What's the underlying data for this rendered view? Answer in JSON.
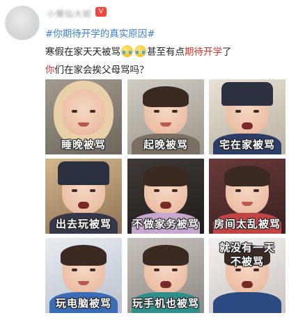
{
  "post": {
    "author": "小懒仙大妮",
    "vip_badge": "V",
    "hashtag": "#你期待开学的真实原因#",
    "line1_before": "寒假在家天天被骂",
    "line1_middle": "甚至有点",
    "line1_accent": "期待开学",
    "line1_after": "了",
    "line2_accent": "你",
    "line2_rest": "们在家会挨父母骂吗？",
    "emoji_icon": "crying-laughing-face-icon"
  },
  "images": [
    {
      "caption": "睡晚被骂",
      "shirt_color": "#e8d1a8",
      "headwear": "hood"
    },
    {
      "caption": "起晚被骂",
      "shirt_color": "#7b6f64",
      "headwear": "hair"
    },
    {
      "caption": "宅在家被骂",
      "shirt_color": "#2d3e66",
      "headwear": "hat"
    },
    {
      "caption": "出去玩被骂",
      "shirt_color": "#35374a",
      "headwear": "hat"
    },
    {
      "caption": "不做家务被骂",
      "shirt_color": "#c7a9cf",
      "headwear": "hair"
    },
    {
      "caption": "房间太乱被骂",
      "shirt_color": "#c24545",
      "headwear": "hair"
    },
    {
      "caption": "玩电脑被骂",
      "shirt_color": "#3a6db5",
      "headwear": "hair"
    },
    {
      "caption": "玩手机也被骂",
      "shirt_color": "#2f8f8a",
      "headwear": "hair"
    },
    {
      "caption": "就没有一天\n不被骂",
      "shirt_color": "#2a4a80",
      "headwear": "hair"
    }
  ]
}
